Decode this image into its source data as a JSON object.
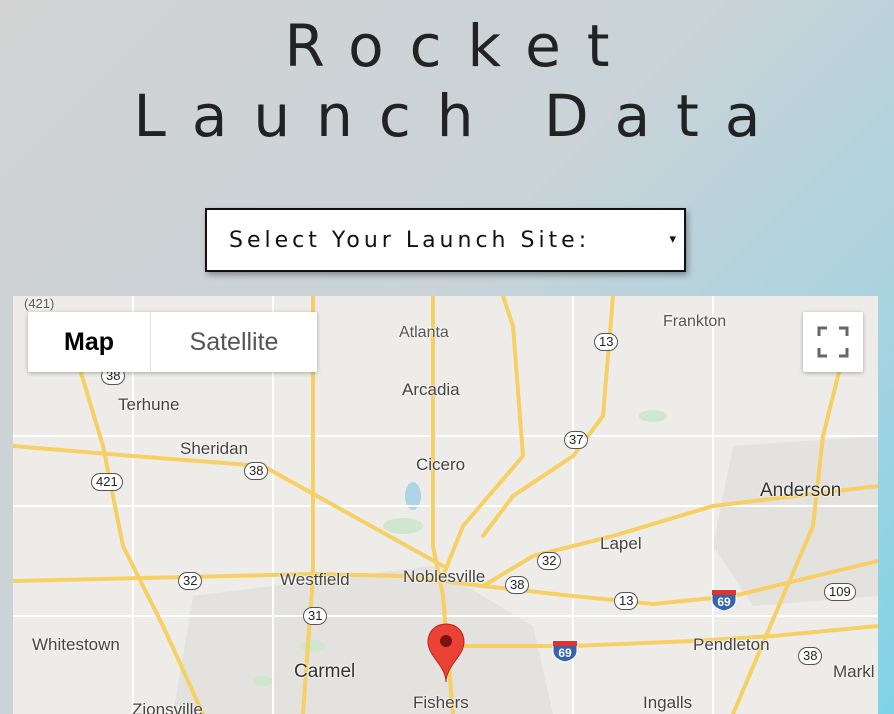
{
  "header": {
    "title_line1": "Rocket",
    "title_line2": "Launch Data"
  },
  "launch_site_select": {
    "label": "Select Your Launch Site:",
    "arrow": "▾"
  },
  "map": {
    "type_controls": {
      "map_label": "Map",
      "satellite_label": "Satellite",
      "selected": "Map"
    },
    "fullscreen_icon": "fullscreen-icon",
    "marker_icon": "map-pin-icon",
    "marker_color": "#ea4335",
    "places": {
      "frankton": "Frankton",
      "atlanta": "Atlanta",
      "arcadia": "Arcadia",
      "terhune": "Terhune",
      "sheridan": "Sheridan",
      "cicero": "Cicero",
      "anderson": "Anderson",
      "lapel": "Lapel",
      "westfield": "Westfield",
      "noblesville": "Noblesville",
      "whitestown": "Whitestown",
      "pendleton": "Pendleton",
      "carmel": "Carmel",
      "fishers": "Fishers",
      "ingalls": "Ingalls",
      "zionsville": "Zionsville",
      "markl": "Markl"
    },
    "routes": {
      "r421_top": "(421)",
      "r38_a": "38",
      "r421": "421",
      "r38_b": "38",
      "r13_top": "13",
      "r37": "37",
      "r32_left": "32",
      "r31": "31",
      "r32_mid": "32",
      "r38_mid": "38",
      "r13_low": "13",
      "r69_top": "69",
      "r109": "109",
      "r69_low": "69",
      "r38_right": "38"
    }
  }
}
